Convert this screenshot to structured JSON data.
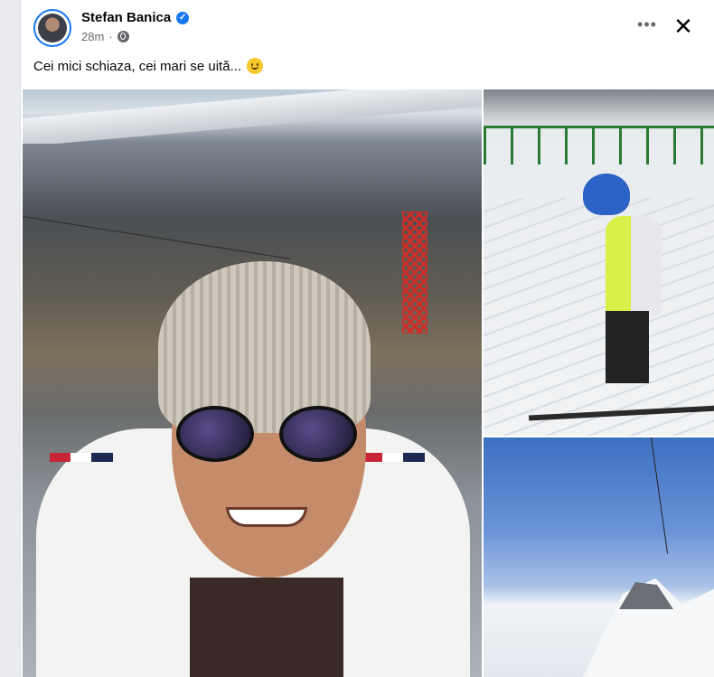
{
  "post": {
    "author": "Stefan Banica",
    "verified_icon": "verified-badge-icon",
    "time": "28m",
    "separator": "·",
    "privacy_icon": "globe-icon",
    "caption": "Cei mici schiaza, cei mari se uită...",
    "caption_emoji": "smiley-emoji-icon"
  },
  "actions": {
    "more_label": "•••",
    "close_label": "✕"
  },
  "photos": [
    {
      "subject": "selfie-photo"
    },
    {
      "subject": "child-skiing-photo"
    },
    {
      "subject": "mountain-sky-photo"
    }
  ],
  "colors": {
    "brand_blue": "#1877f2",
    "meta_gray": "#65676b",
    "text": "#050505"
  }
}
